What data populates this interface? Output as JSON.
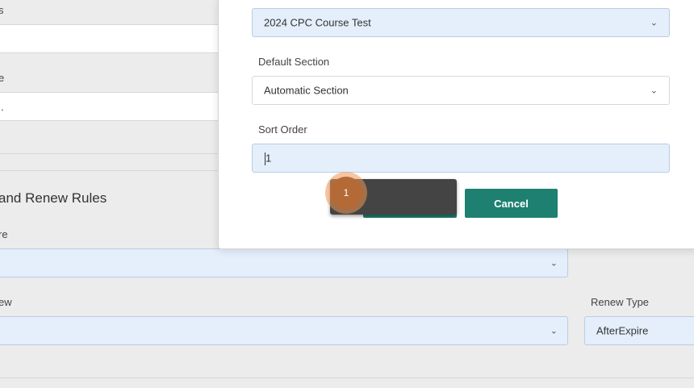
{
  "background": {
    "label_top_partial": "s",
    "label_second_partial": "e",
    "input_second_partial": ".",
    "section_title": "and Renew Rules",
    "expire_label_partial": "re",
    "renew_label_partial": "ew",
    "renew_type_label": "Renew Type",
    "renew_type_value": "AfterExpire"
  },
  "modal": {
    "course_select_value": "2024 CPC Course Test",
    "default_section_label": "Default Section",
    "default_section_value": "Automatic Section",
    "sort_order_label": "Sort Order",
    "sort_order_value": "1",
    "cancel_label": "Cancel"
  },
  "step_badge": "1",
  "colors": {
    "accent": "#1e8070",
    "field_blue": "#e4effb",
    "badge": "#b46a37"
  }
}
